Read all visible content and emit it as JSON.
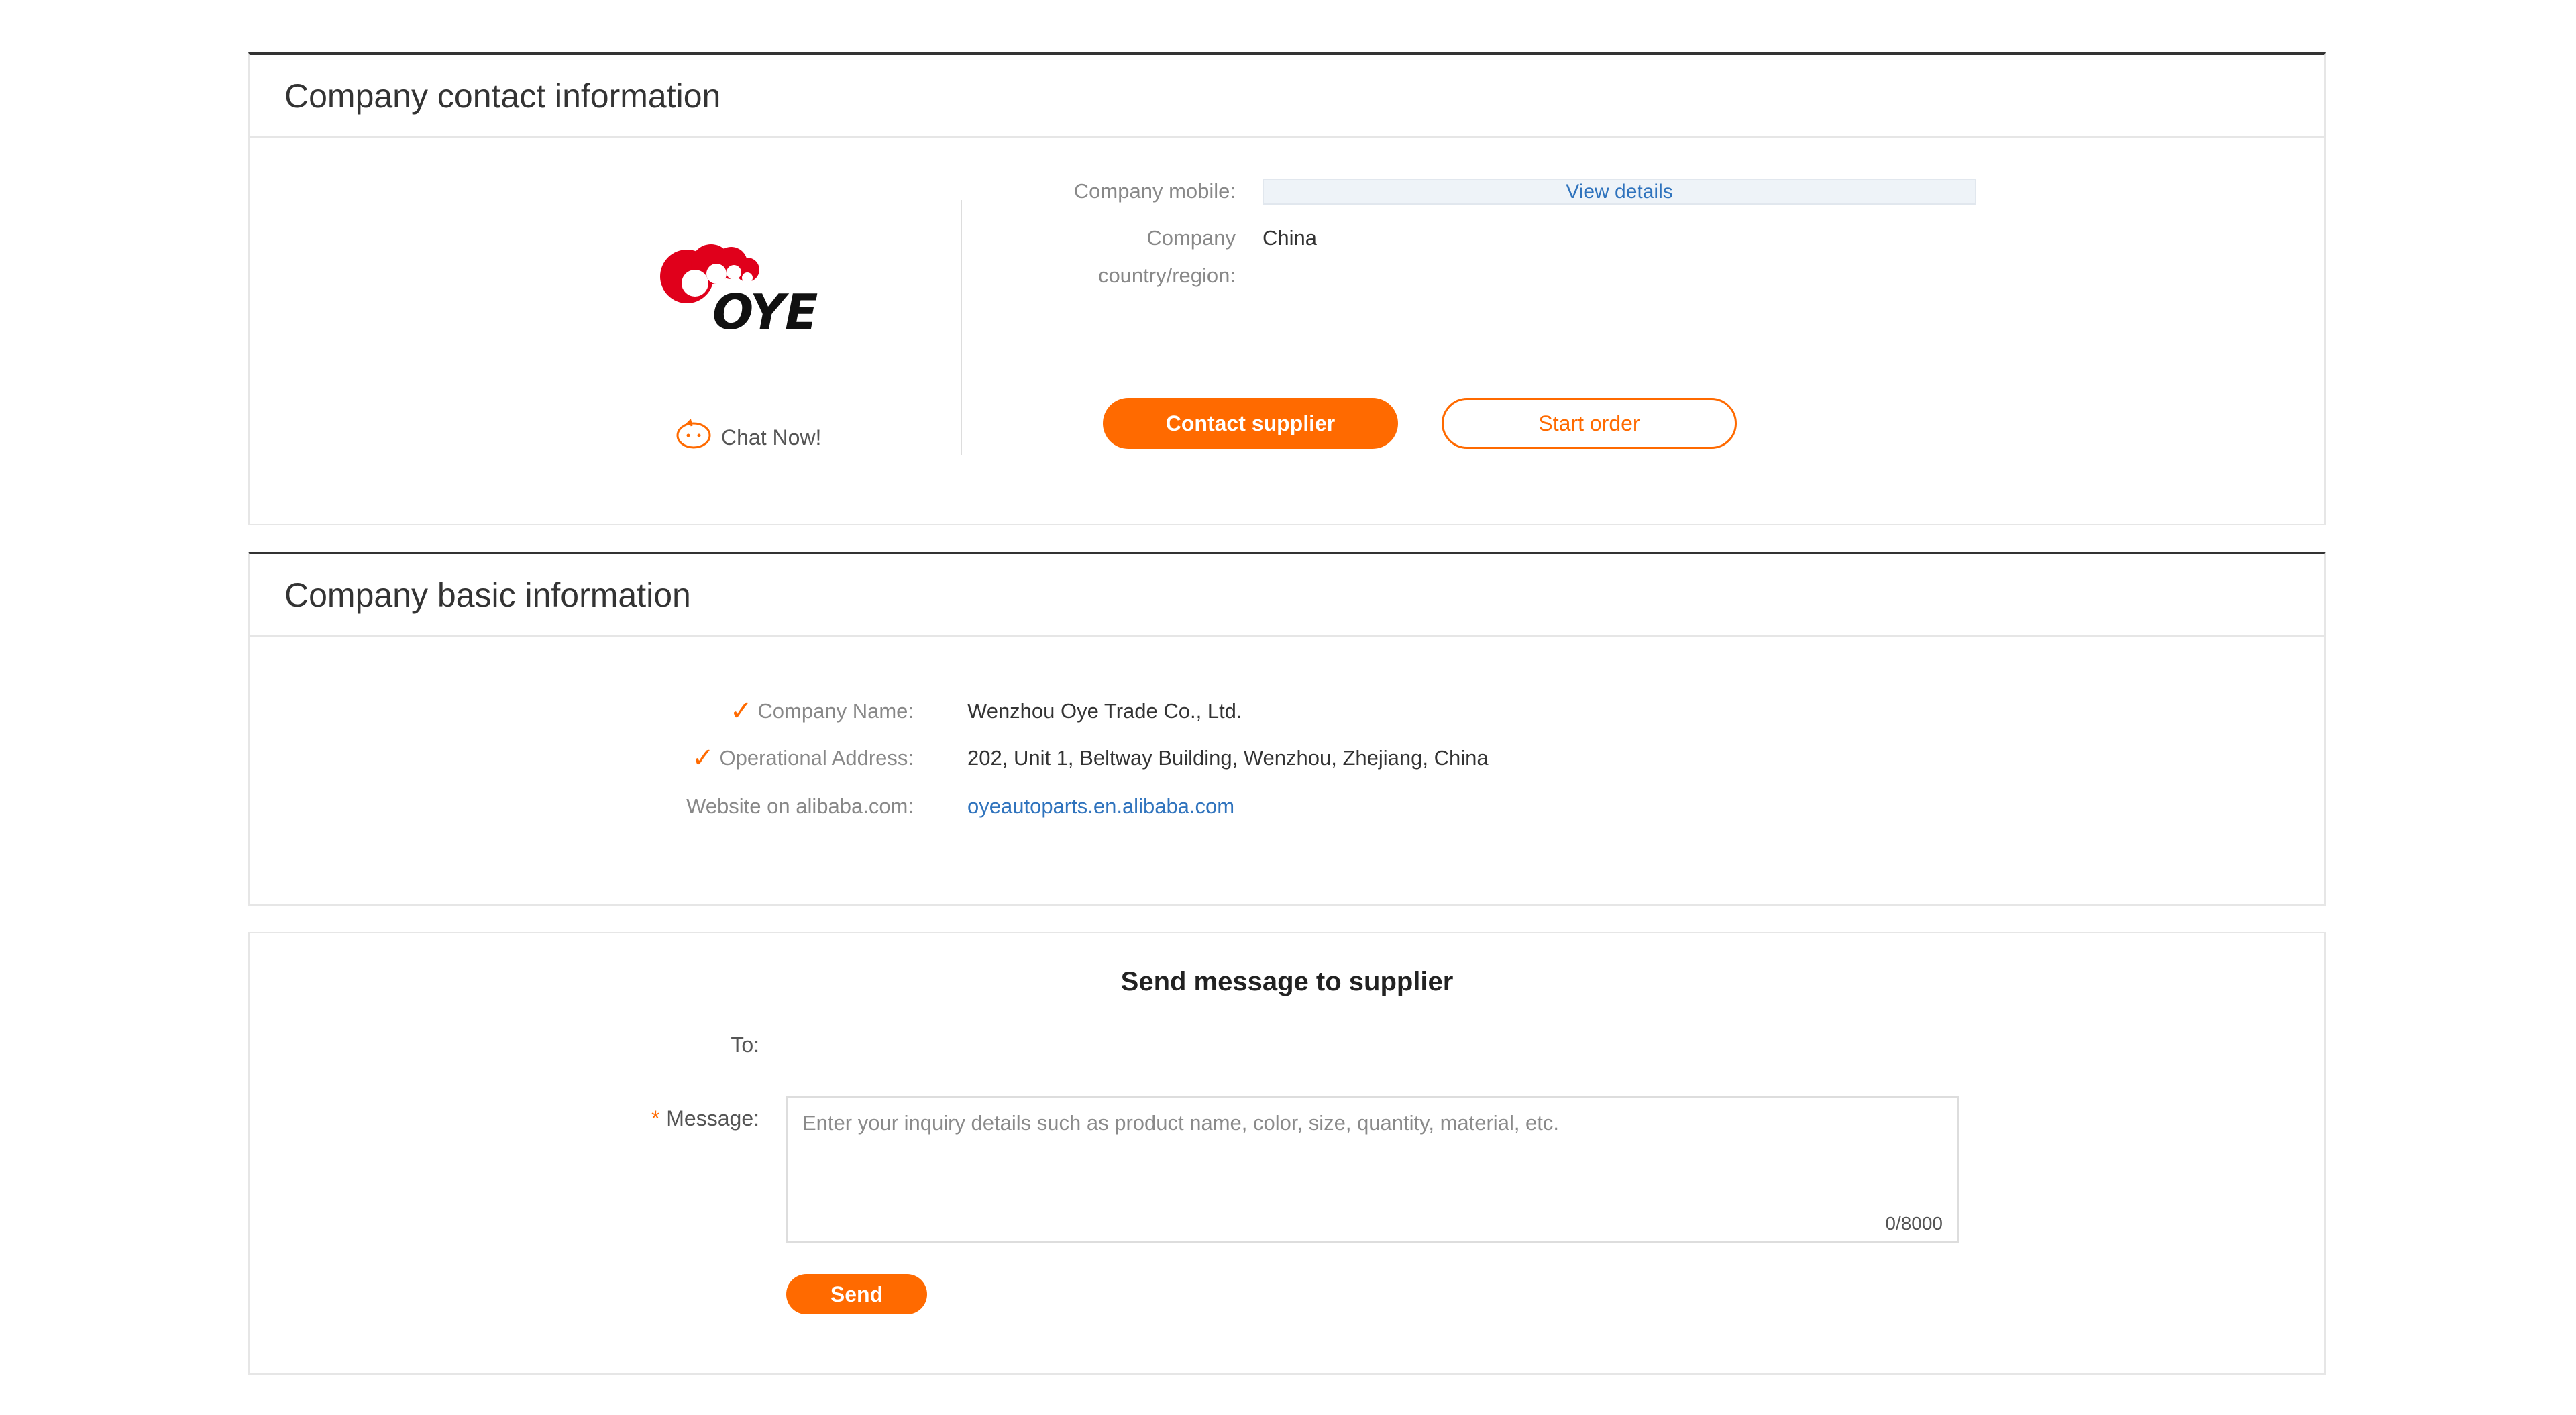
{
  "contact_section": {
    "title": "Company contact information",
    "chat_now": "Chat Now!",
    "mobile_label": "Company mobile:",
    "mobile_action": "View details",
    "country_label_line1": "Company",
    "country_label_line2": "country/region:",
    "country_value": "China",
    "contact_button": "Contact supplier",
    "order_button": "Start order",
    "logo_icon": "oye-company-logo"
  },
  "basic_section": {
    "title": "Company basic information",
    "rows": [
      {
        "label": "Company Name:",
        "value": "Wenzhou Oye Trade Co., Ltd.",
        "verified": true
      },
      {
        "label": "Operational Address:",
        "value": "202, Unit 1, Beltway Building, Wenzhou, Zhejiang, China",
        "verified": true
      },
      {
        "label": "Website on alibaba.com:",
        "value": "oyeautoparts.en.alibaba.com",
        "verified": false
      }
    ]
  },
  "message_section": {
    "title": "Send message to supplier",
    "to_label": "To:",
    "message_label": "Message:",
    "required_mark": "*",
    "placeholder": "Enter your inquiry details such as product name, color, size, quantity, material, etc.",
    "counter": "0/8000",
    "send_button": "Send"
  },
  "colors": {
    "accent": "#ff6a00",
    "link": "#2f73bd",
    "logo_red": "#e0001b",
    "logo_black": "#111111"
  }
}
